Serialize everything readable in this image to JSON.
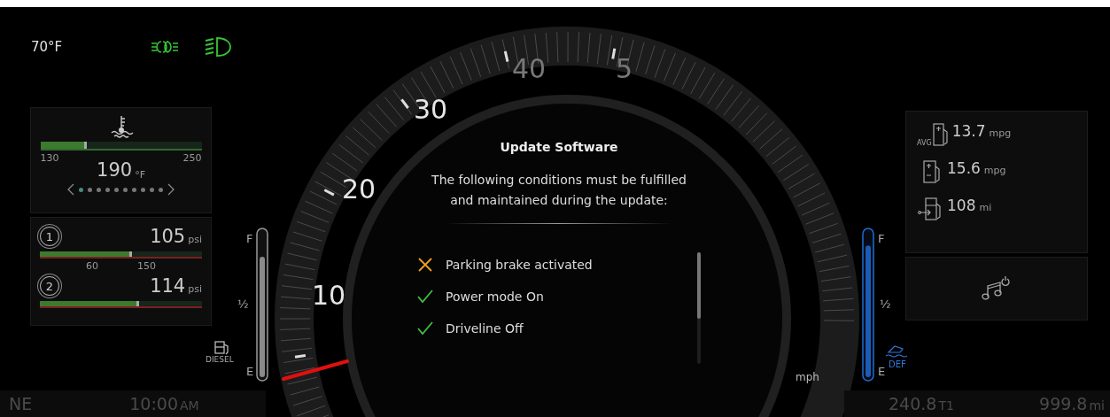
{
  "status": {
    "temperature": "70°F",
    "indicators": [
      {
        "kind": "fog-light",
        "on": true
      },
      {
        "kind": "headlight",
        "on": true
      }
    ]
  },
  "coolant": {
    "min": "130",
    "max": "250",
    "value": "190",
    "unit": "°F",
    "level": 0.29,
    "pages": [
      {
        "selected": true
      },
      {
        "selected": false
      },
      {
        "selected": false
      },
      {
        "selected": false
      },
      {
        "selected": false
      },
      {
        "selected": false
      },
      {
        "selected": false
      },
      {
        "selected": false
      },
      {
        "selected": false
      },
      {
        "selected": false
      }
    ]
  },
  "air_pressure": {
    "scale": [
      "60",
      "150"
    ],
    "circuits": [
      {
        "label": "1",
        "value": "105",
        "unit": "psi",
        "level": 0.57
      },
      {
        "label": "2",
        "value": "114",
        "unit": "psi",
        "level": 0.61
      }
    ]
  },
  "speedometer": {
    "labels": [
      "10",
      "20",
      "30",
      "40",
      "5"
    ],
    "unit": "mph"
  },
  "fuel_gauge": {
    "full": "F",
    "half": "½",
    "empty": "E",
    "fuel": "DIESEL",
    "level": 0.85
  },
  "def_gauge": {
    "full": "F",
    "half": "½",
    "empty": "E",
    "fluid": "DEF",
    "level": 0.93
  },
  "dialog": {
    "title": "Update Software",
    "message": "The following conditions must be fulfilled and maintained during the update:",
    "conditions": [
      {
        "label": "Parking brake activated",
        "met": false
      },
      {
        "label": "Power mode On",
        "met": true
      },
      {
        "label": "Driveline Off",
        "met": true
      }
    ]
  },
  "trip": {
    "rows": [
      {
        "kind": "average",
        "badge": "AVG",
        "value": "13.7",
        "unit": "mpg"
      },
      {
        "kind": "instant",
        "value": "15.6",
        "unit": "mpg"
      },
      {
        "kind": "range",
        "value": "108",
        "unit": "mi"
      }
    ]
  },
  "bottom_bar": {
    "heading": "NE",
    "time": "10:00",
    "meridiem": "AM",
    "trip": "240.8",
    "trip_unit": "T1",
    "odometer": "999.8",
    "odometer_unit": "mi"
  }
}
